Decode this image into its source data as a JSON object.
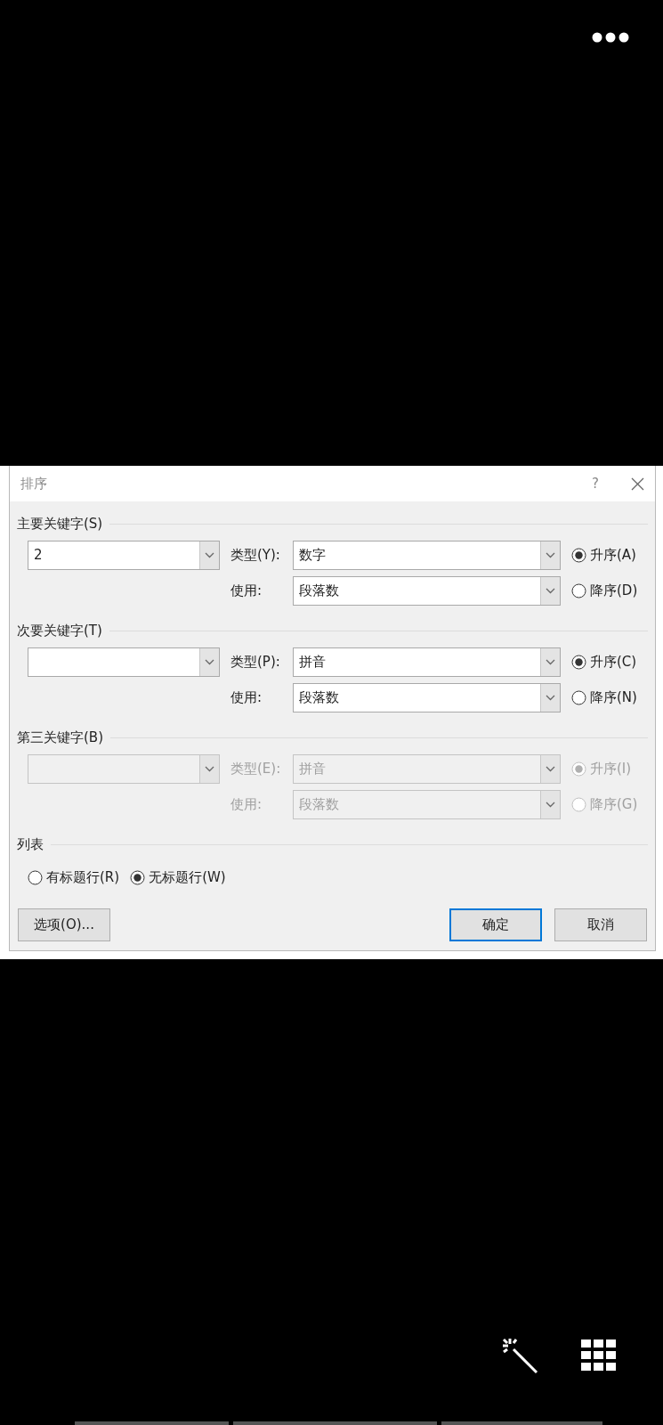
{
  "dialog": {
    "title": "排序",
    "help": "?",
    "sections": [
      {
        "heading": "主要关键字(S)",
        "disabled": false,
        "key": "2",
        "type_label": "类型(Y):",
        "type_value": "数字",
        "use_label": "使用:",
        "use_value": "段落数",
        "order": [
          {
            "label": "升序(A)",
            "selected": true
          },
          {
            "label": "降序(D)",
            "selected": false
          }
        ]
      },
      {
        "heading": "次要关键字(T)",
        "disabled": false,
        "type_label": "类型(P):",
        "type_value": "拼音",
        "use_label": "使用:",
        "use_value": "段落数",
        "order": [
          {
            "label": "升序(C)",
            "selected": true
          },
          {
            "label": "降序(N)",
            "selected": false
          }
        ]
      },
      {
        "heading": "第三关键字(B)",
        "disabled": true,
        "type_label": "类型(E):",
        "type_value": "拼音",
        "use_label": "使用:",
        "use_value": "段落数",
        "order": [
          {
            "label": "升序(I)",
            "selected": true
          },
          {
            "label": "降序(G)",
            "selected": false
          }
        ]
      }
    ],
    "list": {
      "heading": "列表",
      "options": [
        {
          "label": "有标题行(R)",
          "selected": false
        },
        {
          "label": "无标题行(W)",
          "selected": true
        }
      ]
    },
    "buttons": [
      {
        "label": "选项(O)...",
        "default": false
      },
      {
        "label": "确定",
        "default": true
      },
      {
        "label": "取消",
        "default": false
      }
    ]
  }
}
